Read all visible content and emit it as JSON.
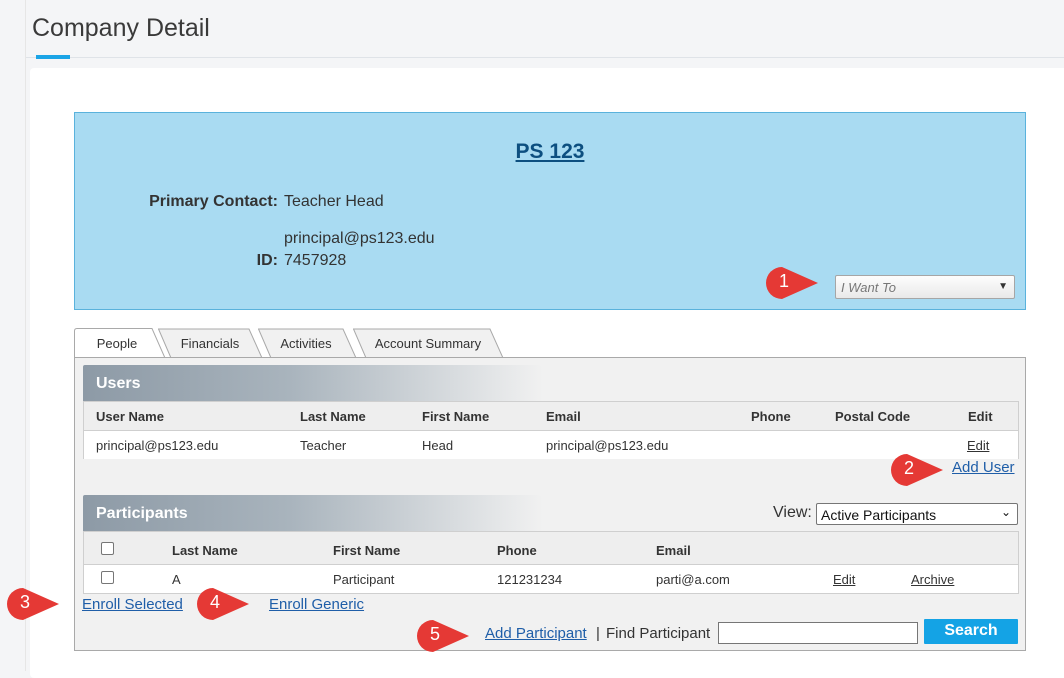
{
  "page": {
    "title": "Company Detail"
  },
  "company": {
    "name": "PS 123",
    "primary_contact_label": "Primary Contact:",
    "primary_contact_name": "Teacher Head",
    "primary_contact_email": "principal@ps123.edu",
    "id_label": "ID:",
    "id_value": "7457928",
    "i_want_to": "I Want To"
  },
  "tabs": [
    {
      "label": "People",
      "active": true
    },
    {
      "label": "Financials",
      "active": false
    },
    {
      "label": "Activities",
      "active": false
    },
    {
      "label": "Account Summary",
      "active": false
    }
  ],
  "users": {
    "title": "Users",
    "columns": [
      "User Name",
      "Last Name",
      "First Name",
      "Email",
      "Phone",
      "Postal Code",
      "Edit"
    ],
    "rows": [
      {
        "user_name": "principal@ps123.edu",
        "last_name": "Teacher",
        "first_name": "Head",
        "email": "principal@ps123.edu",
        "phone": "",
        "postal_code": "",
        "edit": "Edit"
      }
    ],
    "add_link": "Add User"
  },
  "participants": {
    "title": "Participants",
    "view_label": "View:",
    "view_selected": "Active Participants",
    "columns": [
      "Last Name",
      "First Name",
      "Phone",
      "Email"
    ],
    "rows": [
      {
        "last_name": "A",
        "first_name": "Participant",
        "phone": "121231234",
        "email": "parti@a.com",
        "edit": "Edit",
        "archive": "Archive"
      }
    ],
    "enroll_selected": "Enroll Selected",
    "enroll_generic": "Enroll Generic",
    "add_participant": "Add Participant",
    "separator": "|",
    "find_label": "Find Participant",
    "search_button": "Search"
  },
  "callouts": [
    "1",
    "2",
    "3",
    "4",
    "5"
  ],
  "colors": {
    "accent": "#14a3e5",
    "callout": "#e53935",
    "company_bg": "#a9dbf2",
    "link": "#1f5ea8"
  }
}
